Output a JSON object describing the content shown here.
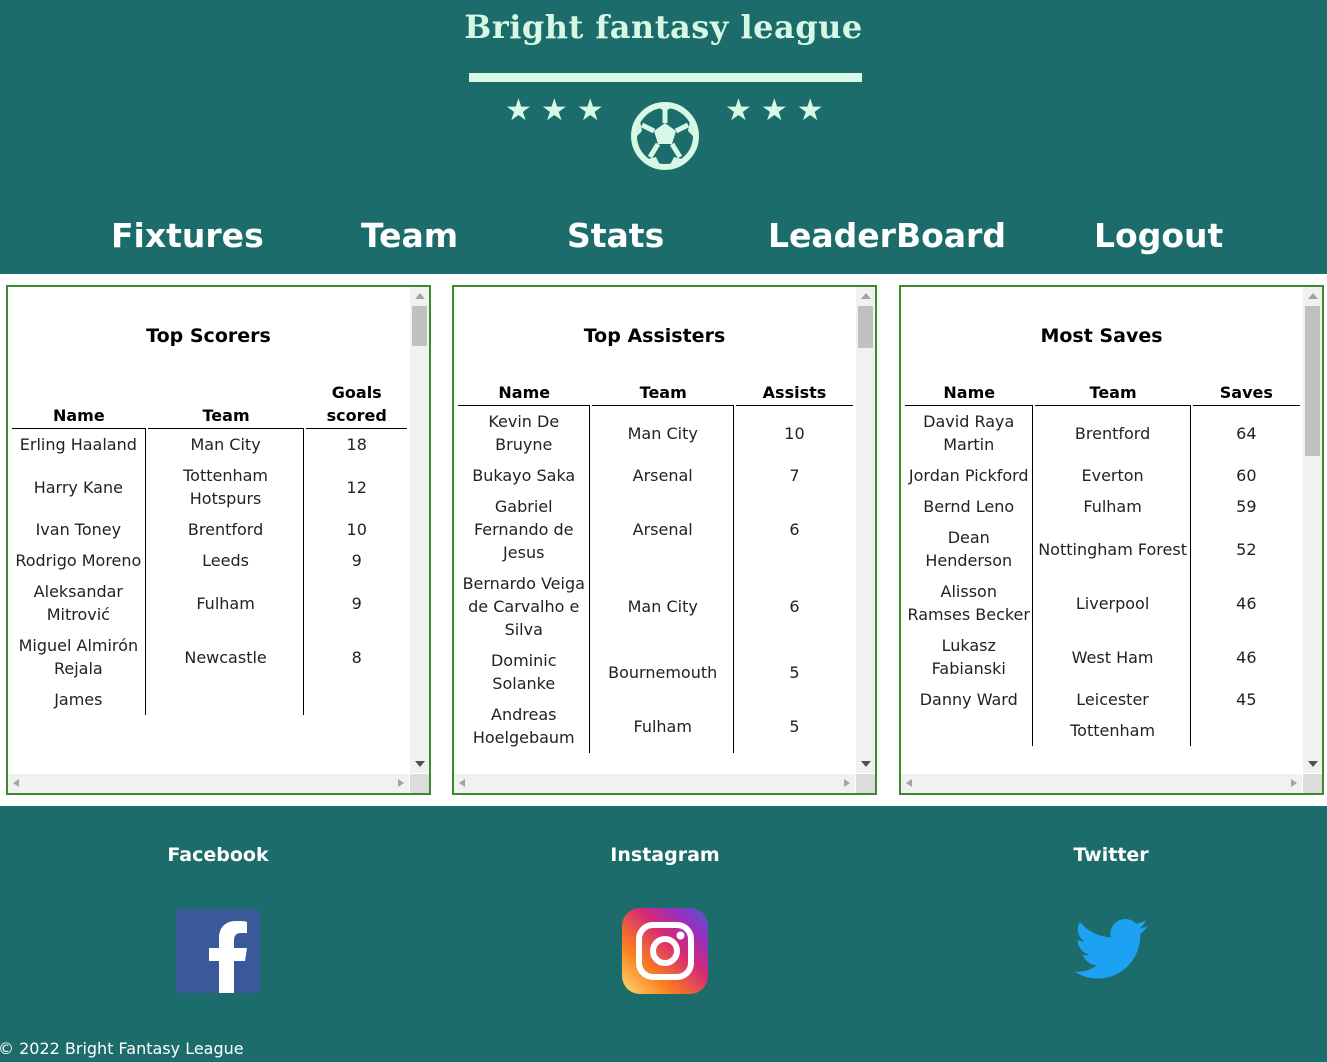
{
  "site": {
    "title": "Bright fantasy league",
    "stars_left": "★★★",
    "stars_right": "★★★",
    "logo_icon": "soccer-ball-icon"
  },
  "nav": [
    {
      "label": "Fixtures"
    },
    {
      "label": "Team"
    },
    {
      "label": "Stats"
    },
    {
      "label": "LeaderBoard"
    },
    {
      "label": "Logout"
    }
  ],
  "panels": [
    {
      "title": "Top Scorers",
      "columns": [
        "Name",
        "Team",
        "Goals scored"
      ],
      "rows": [
        [
          "Erling Haaland",
          "Man City",
          "18"
        ],
        [
          "Harry Kane",
          "Tottenham Hotspurs",
          "12"
        ],
        [
          "Ivan Toney",
          "Brentford",
          "10"
        ],
        [
          "Rodrigo Moreno",
          "Leeds",
          "9"
        ],
        [
          "Aleksandar Mitrović",
          "Fulham",
          "9"
        ],
        [
          "Miguel Almirón Rejala",
          "Newcastle",
          "8"
        ],
        [
          "James",
          "",
          ""
        ]
      ]
    },
    {
      "title": "Top Assisters",
      "columns": [
        "Name",
        "Team",
        "Assists"
      ],
      "rows": [
        [
          "Kevin De Bruyne",
          "Man City",
          "10"
        ],
        [
          "Bukayo Saka",
          "Arsenal",
          "7"
        ],
        [
          "Gabriel Fernando de Jesus",
          "Arsenal",
          "6"
        ],
        [
          "Bernardo Veiga de Carvalho e Silva",
          "Man City",
          "6"
        ],
        [
          "Dominic Solanke",
          "Bournemouth",
          "5"
        ],
        [
          "Andreas Hoelgebaum",
          "Fulham",
          "5"
        ]
      ]
    },
    {
      "title": "Most Saves",
      "columns": [
        "Name",
        "Team",
        "Saves"
      ],
      "rows": [
        [
          "David Raya Martin",
          "Brentford",
          "64"
        ],
        [
          "Jordan Pickford",
          "Everton",
          "60"
        ],
        [
          "Bernd Leno",
          "Fulham",
          "59"
        ],
        [
          "Dean Henderson",
          "Nottingham Forest",
          "52"
        ],
        [
          "Alisson Ramses Becker",
          "Liverpool",
          "46"
        ],
        [
          "Lukasz Fabianski",
          "West Ham",
          "46"
        ],
        [
          "Danny Ward",
          "Leicester",
          "45"
        ],
        [
          "",
          "Tottenham",
          ""
        ]
      ]
    }
  ],
  "social": [
    {
      "label": "Facebook",
      "icon": "facebook-icon",
      "color": "#3b5998"
    },
    {
      "label": "Instagram",
      "icon": "instagram-icon",
      "color": "#e1306c"
    },
    {
      "label": "Twitter",
      "icon": "twitter-icon",
      "color": "#1da1f2"
    }
  ],
  "footer": {
    "copyright": "© 2022 Bright Fantasy League"
  },
  "colors": {
    "primary": "#1c6c6b",
    "accent": "#d6f8e4",
    "panel_border": "#3b8a2e"
  }
}
